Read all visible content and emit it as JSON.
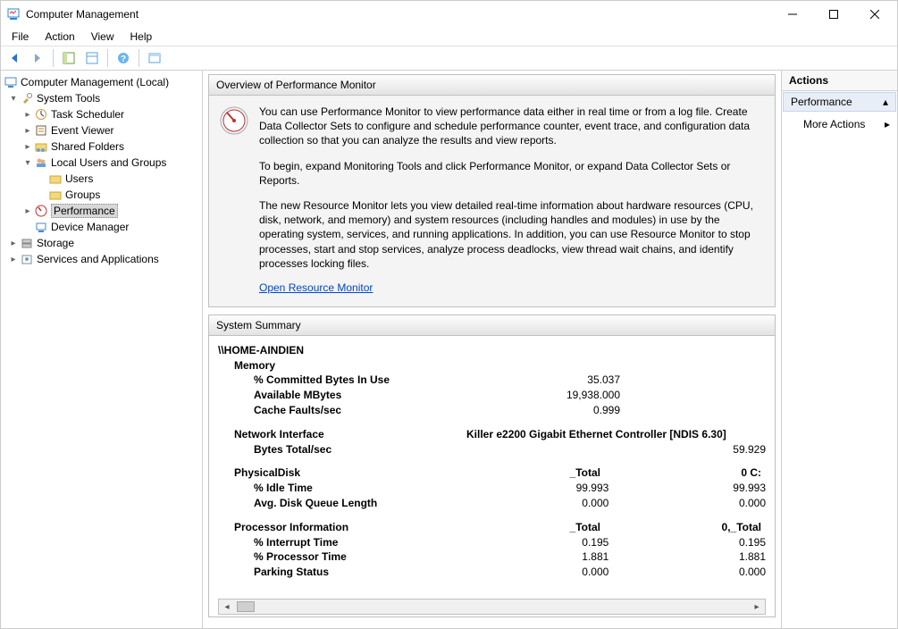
{
  "window": {
    "title": "Computer Management"
  },
  "menubar": {
    "items": [
      "File",
      "Action",
      "View",
      "Help"
    ]
  },
  "tree": {
    "root": "Computer Management (Local)",
    "system_tools": "System Tools",
    "task_scheduler": "Task Scheduler",
    "event_viewer": "Event Viewer",
    "shared_folders": "Shared Folders",
    "local_users": "Local Users and Groups",
    "users": "Users",
    "groups": "Groups",
    "performance": "Performance",
    "device_manager": "Device Manager",
    "storage": "Storage",
    "services": "Services and Applications"
  },
  "overview": {
    "title": "Overview of Performance Monitor",
    "p1": "You can use Performance Monitor to view performance data either in real time or from a log file. Create Data Collector Sets to configure and schedule performance counter, event trace, and configuration data collection so that you can analyze the results and view reports.",
    "p2": "To begin, expand Monitoring Tools and click Performance Monitor, or expand Data Collector Sets or Reports.",
    "p3": "The new Resource Monitor lets you view detailed real-time information about hardware resources (CPU, disk, network, and memory) and system resources (including handles and modules) in use by the operating system, services, and running applications. In addition, you can use Resource Monitor to stop processes, start and stop services, analyze process deadlocks, view thread wait chains, and identify processes locking files.",
    "link": "Open Resource Monitor"
  },
  "summary": {
    "title": "System Summary",
    "host": "\\\\HOME-AINDIEN",
    "memory_h": "Memory",
    "memory": [
      {
        "label": "% Committed Bytes In Use",
        "v": "35.037"
      },
      {
        "label": "Available MBytes",
        "v": "19,938.000"
      },
      {
        "label": "Cache Faults/sec",
        "v": "0.999"
      }
    ],
    "net_h": "Network Interface",
    "net_col": "Killer e2200 Gigabit Ethernet Controller [NDIS 6.30]",
    "net": [
      {
        "label": "Bytes Total/sec",
        "v": "59.929"
      }
    ],
    "disk_h": "PhysicalDisk",
    "disk_c1": "_Total",
    "disk_c2": "0 C:",
    "disk": [
      {
        "label": "% Idle Time",
        "v1": "99.993",
        "v2": "99.993"
      },
      {
        "label": "Avg. Disk Queue Length",
        "v1": "0.000",
        "v2": "0.000"
      }
    ],
    "proc_h": "Processor Information",
    "proc_c1": "_Total",
    "proc_c2": "0,_Total",
    "proc": [
      {
        "label": "% Interrupt Time",
        "v1": "0.195",
        "v2": "0.195"
      },
      {
        "label": "% Processor Time",
        "v1": "1.881",
        "v2": "1.881"
      },
      {
        "label": "Parking Status",
        "v1": "0.000",
        "v2": "0.000"
      }
    ]
  },
  "actions": {
    "heading": "Actions",
    "section": "Performance",
    "more": "More Actions"
  }
}
